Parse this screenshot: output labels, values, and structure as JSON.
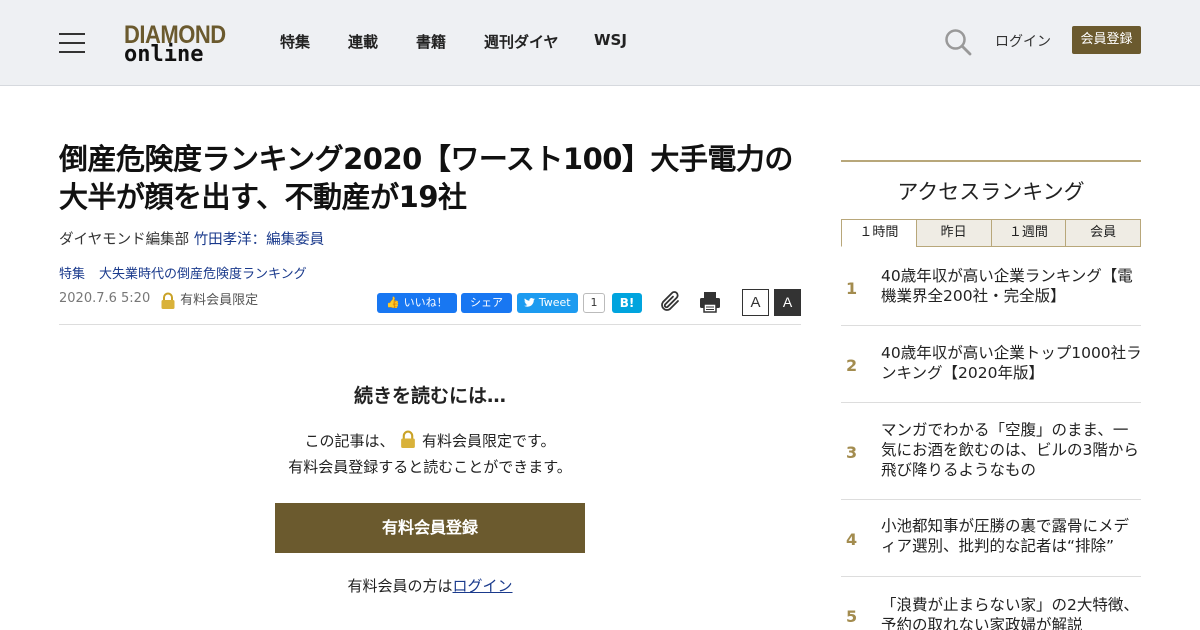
{
  "header": {
    "logo_top": "DIAMOND",
    "logo_bottom": "online",
    "nav": [
      "特集",
      "連載",
      "書籍",
      "週刊ダイヤ",
      "WSJ"
    ],
    "login": "ログイン",
    "register": "会員登録"
  },
  "article": {
    "title": "倒産危険度ランキング2020【ワースト100】大手電力の大半が顔を出す、不動産が19社",
    "byline_prefix": "ダイヤモンド編集部 ",
    "byline_author": "竹田孝洋：編集委員",
    "tags": [
      "特集",
      "大失業時代の倒産危険度ランキング"
    ],
    "date": "2020.7.6 5:20",
    "member_only": "有料会員限定",
    "share": {
      "fb_like": "いいね！",
      "fb_share": "シェア",
      "tweet": "Tweet",
      "tweet_count": "1",
      "hatena": "B!"
    },
    "font_small": "A",
    "font_large": "A"
  },
  "paywall": {
    "heading": "続きを読むには…",
    "line1_before": "この記事は、",
    "line1_after": "有料会員限定です。",
    "line2": "有料会員登録すると読むことができます。",
    "button": "有料会員登録",
    "login_prefix": "有料会員の方は",
    "login_link": "ログイン"
  },
  "ranking": {
    "title": "アクセスランキング",
    "tabs": [
      "１時間",
      "昨日",
      "１週間",
      "会員"
    ],
    "active_tab": 0,
    "items": [
      {
        "rank": "1",
        "text": "40歳年収が高い企業ランキング【電機業界全200社・完全版】"
      },
      {
        "rank": "2",
        "text": "40歳年収が高い企業トップ1000社ランキング【2020年版】"
      },
      {
        "rank": "3",
        "text": "マンガでわかる「空腹」のまま、一気にお酒を飲むのは、ビルの3階から飛び降りるようなもの"
      },
      {
        "rank": "4",
        "text": "小池都知事が圧勝の裏で露骨にメディア選別、批判的な記者は“排除”"
      },
      {
        "rank": "5",
        "text": "「浪費が止まらない家」の2大特徴、予約の取れない家政婦が解説"
      }
    ]
  },
  "colors": {
    "brand": "#6b5a2e",
    "header_bg": "#eef0f3",
    "link": "#1a3a8c",
    "rank_num": "#a38c4f",
    "facebook": "#1877f2",
    "twitter": "#1d9bf0",
    "hatena": "#00a4de"
  }
}
